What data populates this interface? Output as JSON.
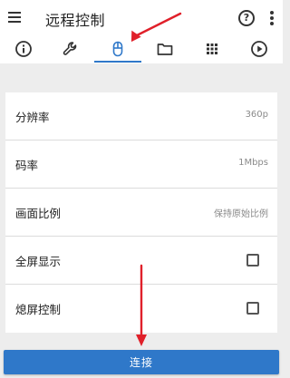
{
  "header": {
    "title": "远程控制",
    "menu_icon": "menu-icon",
    "help_icon": "help-icon",
    "help_glyph": "?",
    "more_icon": "more-vertical-icon"
  },
  "tabs": [
    {
      "icon": "info-icon",
      "active": false
    },
    {
      "icon": "wrench-icon",
      "active": false
    },
    {
      "icon": "mouse-icon",
      "active": true
    },
    {
      "icon": "folder-icon",
      "active": false
    },
    {
      "icon": "grid-icon",
      "active": false
    },
    {
      "icon": "play-circle-icon",
      "active": false
    }
  ],
  "settings": {
    "resolution": {
      "label": "分辨率",
      "value": "360p"
    },
    "bitrate": {
      "label": "码率",
      "value": "1Mbps"
    },
    "aspect_ratio": {
      "label": "画面比例",
      "value": "保持原始比例"
    },
    "fullscreen": {
      "label": "全屏显示",
      "checked": false
    },
    "screen_off": {
      "label": "熄屏控制",
      "checked": false
    }
  },
  "connect_button": {
    "label": "连接"
  },
  "colors": {
    "accent": "#2f78c9",
    "annotation_arrow": "#e0202a",
    "background": "#ededed"
  }
}
